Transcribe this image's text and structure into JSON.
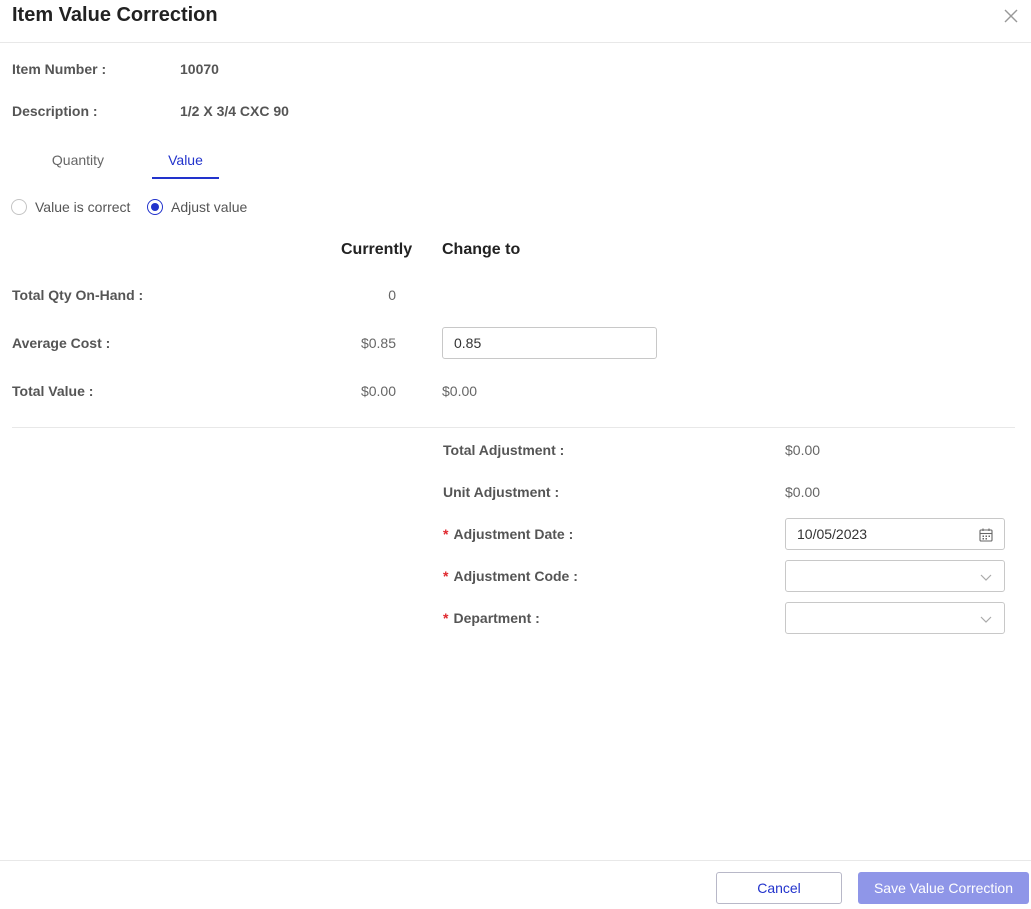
{
  "dialog": {
    "title": "Item Value Correction"
  },
  "item": {
    "number_label": "Item Number :",
    "number_value": "10070",
    "description_label": "Description :",
    "description_value": "1/2 X 3/4 CXC 90"
  },
  "tabs": [
    {
      "label": "Quantity",
      "active": false
    },
    {
      "label": "Value",
      "active": true
    }
  ],
  "radio_options": [
    {
      "label": "Value is correct",
      "checked": false
    },
    {
      "label": "Adjust value",
      "checked": true
    }
  ],
  "columns": {
    "currently": "Currently",
    "change_to": "Change to"
  },
  "rows": {
    "total_qty_label": "Total Qty On-Hand :",
    "total_qty_current": "0",
    "average_cost_label": "Average Cost :",
    "average_cost_current": "$0.85",
    "average_cost_change": "0.85",
    "total_value_label": "Total Value :",
    "total_value_current": "$0.00",
    "total_value_change": "$0.00"
  },
  "adjustment": {
    "total_label": "Total Adjustment :",
    "total_value": "$0.00",
    "unit_label": "Unit Adjustment :",
    "unit_value": "$0.00",
    "required_mark": "*",
    "date_label": "Adjustment Date :",
    "date_value": "10/05/2023",
    "code_label": "Adjustment Code :",
    "code_value": "",
    "department_label": "Department :",
    "department_value": ""
  },
  "footer": {
    "cancel_label": "Cancel",
    "save_label": "Save Value Correction"
  },
  "colors": {
    "accent": "#2233cc",
    "save_button": "#8f96e8",
    "required": "#e0282e"
  },
  "icons": {
    "close": "close-icon",
    "calendar": "calendar-icon",
    "dropdown": "chevron-down-icon"
  }
}
